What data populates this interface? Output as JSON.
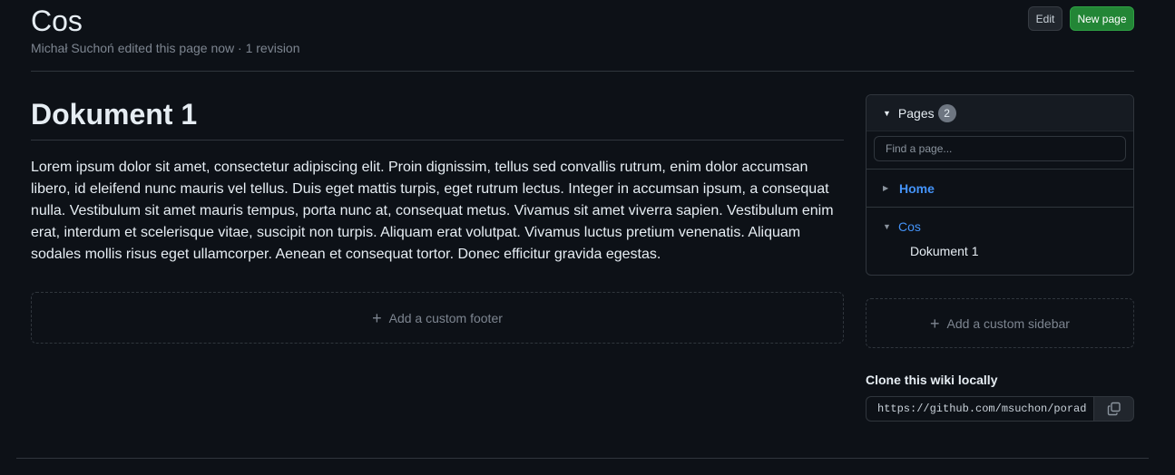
{
  "header": {
    "title": "Cos",
    "meta": "Michał Suchoń edited this page now · 1 revision",
    "edit_label": "Edit",
    "new_page_label": "New page"
  },
  "content": {
    "heading": "Dokument 1",
    "body": "Lorem ipsum dolor sit amet, consectetur adipiscing elit. Proin dignissim, tellus sed convallis rutrum, enim dolor accumsan libero, id eleifend nunc mauris vel tellus. Duis eget mattis turpis, eget rutrum lectus. Integer in accumsan ipsum, a consequat nulla. Vestibulum sit amet mauris tempus, porta nunc at, consequat metus. Vivamus sit amet viverra sapien. Vestibulum enim erat, interdum et scelerisque vitae, suscipit non turpis. Aliquam erat volutpat. Vivamus luctus pretium venenatis. Aliquam sodales mollis risus eget ullamcorper. Aenean et consequat tortor. Donec efficitur gravida egestas.",
    "footer_label": "Add a custom footer"
  },
  "sidebar": {
    "pages_label": "Pages",
    "pages_count": "2",
    "search_placeholder": "Find a page...",
    "pages": [
      {
        "label": "Home",
        "expanded": false
      },
      {
        "label": "Cos",
        "expanded": true,
        "children": [
          "Dokument 1"
        ]
      }
    ],
    "custom_sidebar_label": "Add a custom sidebar",
    "clone_title": "Clone this wiki locally",
    "clone_url": "https://github.com/msuchon/porad"
  },
  "colors": {
    "background": "#0d1117",
    "accent_link": "#4493f8",
    "primary_button": "#238636",
    "border": "#30363d"
  }
}
